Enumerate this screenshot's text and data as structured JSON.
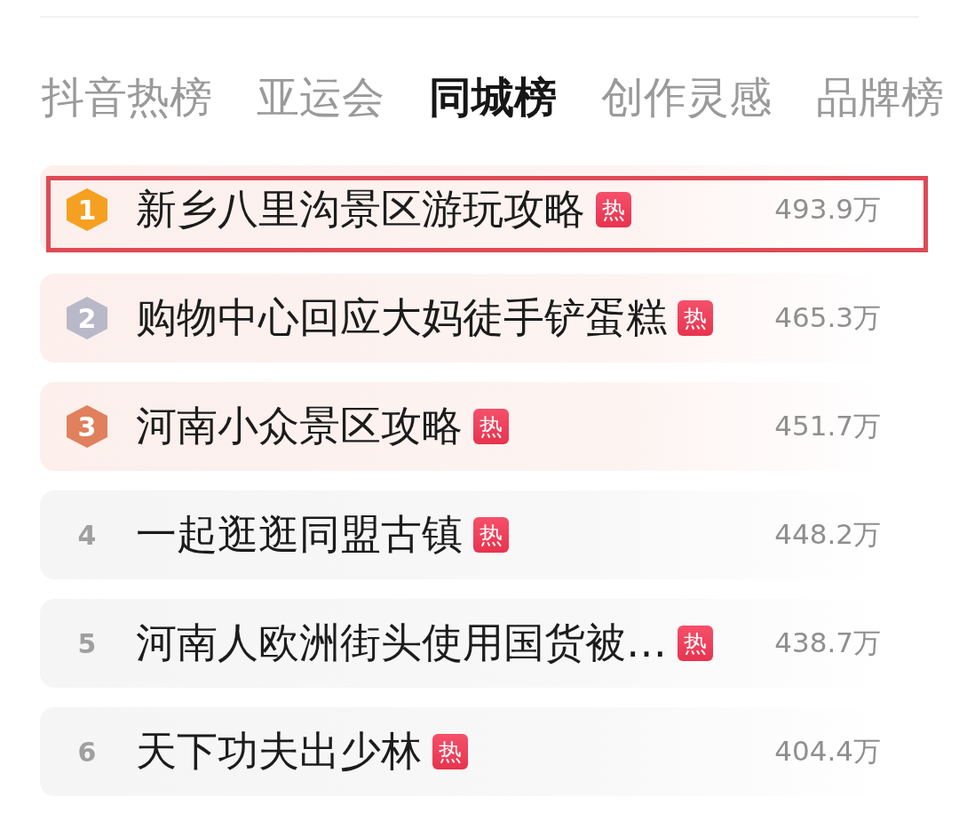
{
  "tabs": [
    {
      "label": "抖音热榜",
      "selected": false
    },
    {
      "label": "亚运会",
      "selected": false
    },
    {
      "label": "同城榜",
      "selected": true
    },
    {
      "label": "创作灵感",
      "selected": false
    },
    {
      "label": "品牌榜",
      "selected": false
    }
  ],
  "rows": [
    {
      "rank": "1",
      "kind": "medal",
      "color": "#f5a020",
      "title": "新乡八里沟景区游玩攻略",
      "hot": "热",
      "value": "493.9万",
      "highlighted": true
    },
    {
      "rank": "2",
      "kind": "medal",
      "color": "#b8b8c8",
      "title": "购物中心回应大妈徒手铲蛋糕",
      "hot": "热",
      "value": "465.3万",
      "highlighted": false
    },
    {
      "rank": "3",
      "kind": "medal",
      "color": "#e0805c",
      "title": "河南小众景区攻略",
      "hot": "热",
      "value": "451.7万",
      "highlighted": false
    },
    {
      "rank": "4",
      "kind": "plain",
      "title": "一起逛逛同盟古镇",
      "hot": "热",
      "value": "448.2万",
      "highlighted": false
    },
    {
      "rank": "5",
      "kind": "plain",
      "title": "河南人欧洲街头使用国货被…",
      "hot": "热",
      "value": "438.7万",
      "highlighted": false
    },
    {
      "rank": "6",
      "kind": "plain",
      "title": "天下功夫出少林",
      "hot": "热",
      "value": "404.4万",
      "highlighted": false
    }
  ]
}
